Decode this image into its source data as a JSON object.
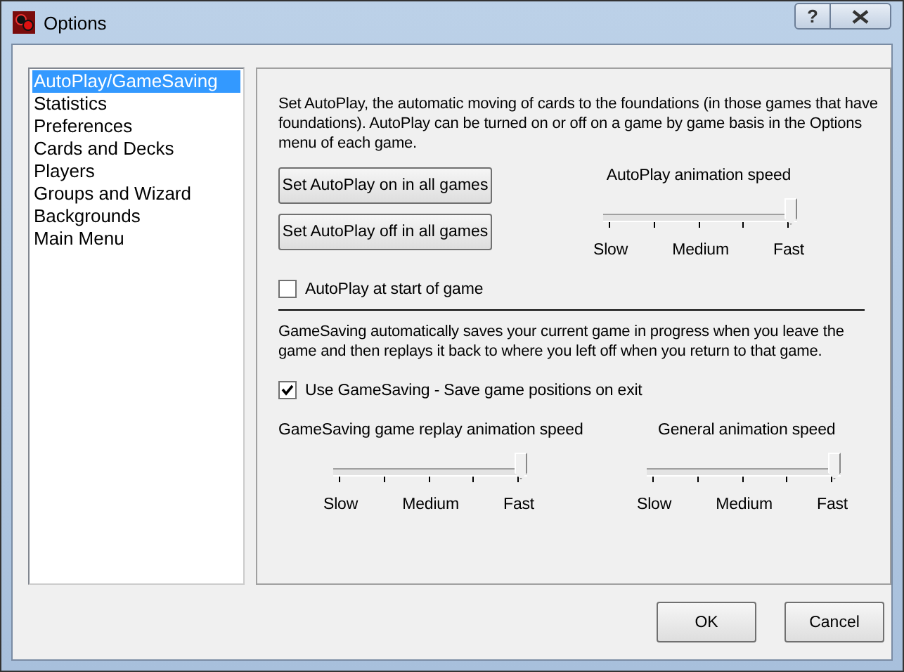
{
  "window": {
    "title": "Options",
    "help_button": "?"
  },
  "sidebar": {
    "items": [
      {
        "label": "AutoPlay/GameSaving",
        "selected": true
      },
      {
        "label": "Statistics",
        "selected": false
      },
      {
        "label": "Preferences",
        "selected": false
      },
      {
        "label": "Cards and Decks",
        "selected": false
      },
      {
        "label": "Players",
        "selected": false
      },
      {
        "label": "Groups and Wizard",
        "selected": false
      },
      {
        "label": "Backgrounds",
        "selected": false
      },
      {
        "label": "Main Menu",
        "selected": false
      }
    ]
  },
  "autoplay": {
    "description": "Set AutoPlay, the automatic moving of cards to the foundations (in those games that have foundations).  AutoPlay can be turned on or off on a game by game basis in the Options menu of each game.",
    "buttons": [
      "Set AutoPlay on in all games",
      "Set AutoPlay off in all games"
    ],
    "slider": {
      "label": "AutoPlay animation speed",
      "level": 1,
      "ticks": [
        "Slow",
        "Medium",
        "Fast"
      ]
    },
    "checkbox": {
      "label": "AutoPlay at start of game",
      "checked": false
    }
  },
  "gamesaving": {
    "description": "GameSaving automatically saves your current game in progress when you leave the game and then replays it back to where you left off when you return to that game.",
    "checkbox": {
      "label": "Use GameSaving - Save game positions on exit",
      "checked": true
    },
    "sliders": [
      {
        "label": "GameSaving game replay animation speed",
        "level": 1,
        "ticks": [
          "Slow",
          "Medium",
          "Fast"
        ]
      },
      {
        "label": "General animation speed",
        "level": 1,
        "ticks": [
          "Slow",
          "Medium",
          "Fast"
        ]
      }
    ]
  },
  "buttons": [
    "OK",
    "Cancel"
  ]
}
